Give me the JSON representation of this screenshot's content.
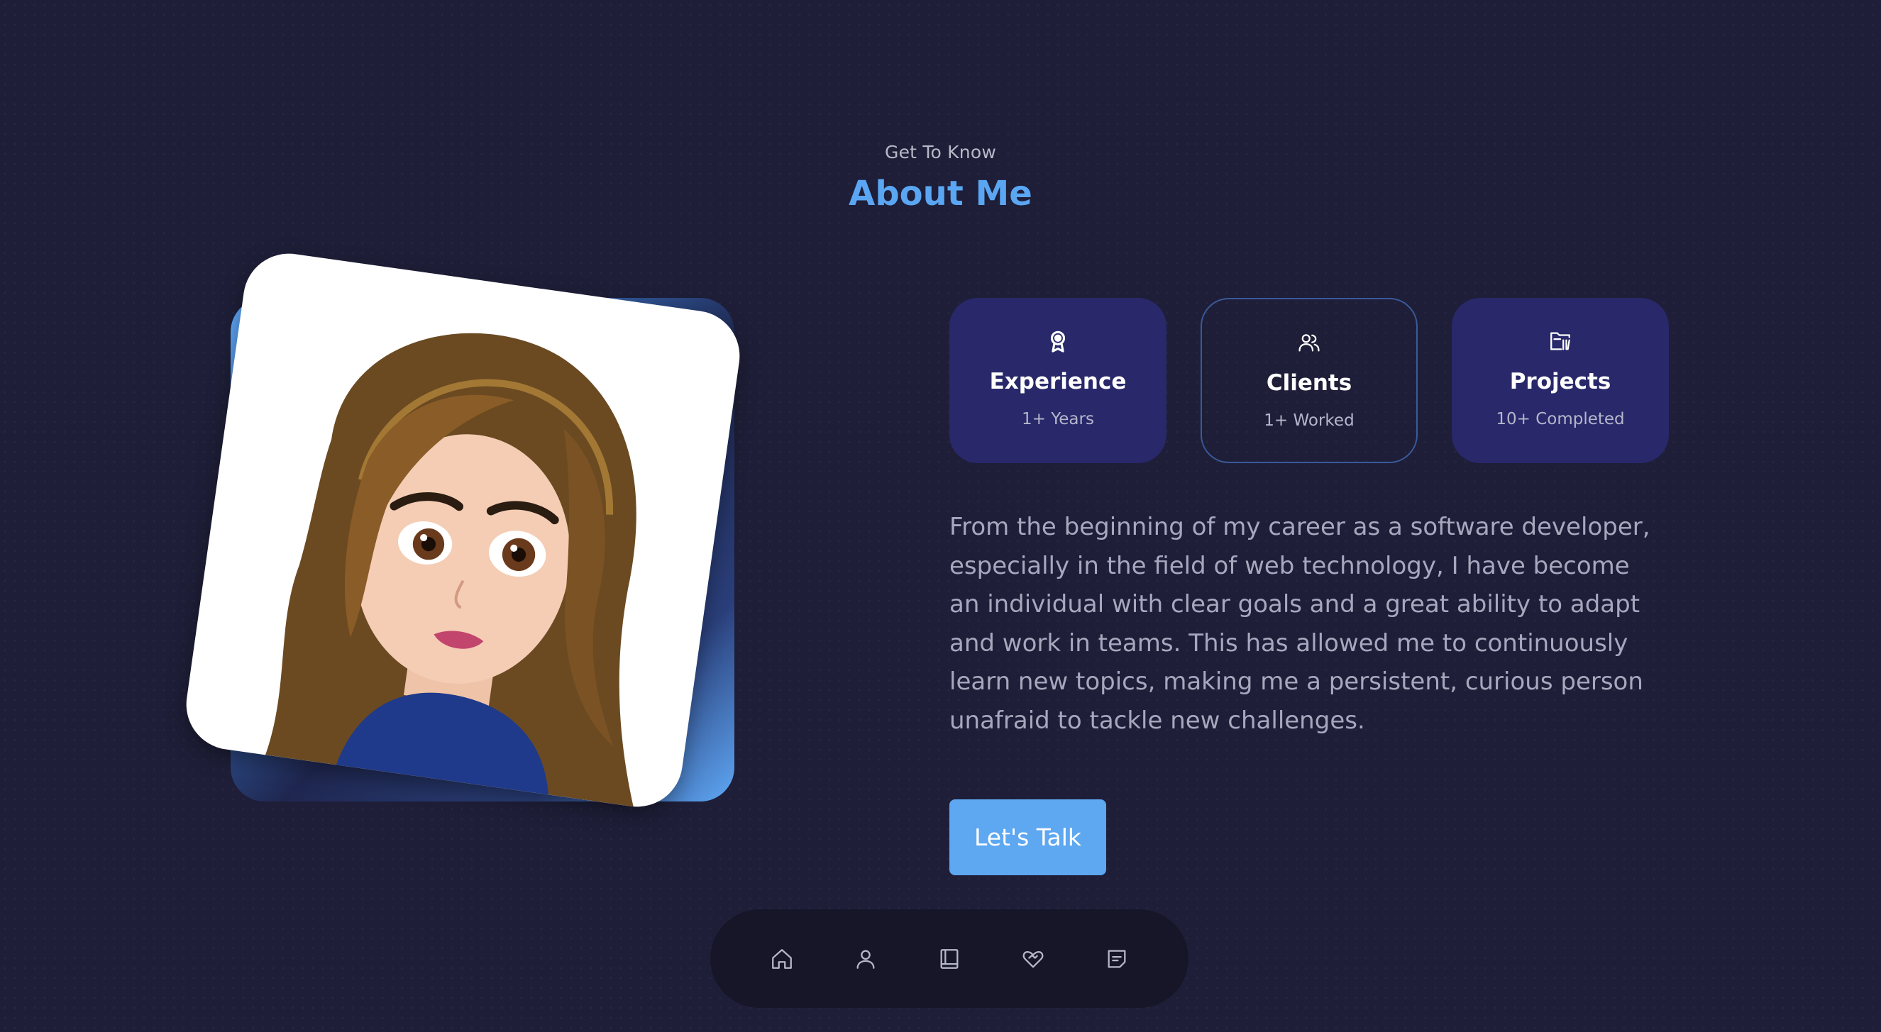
{
  "header": {
    "kicker": "Get To Know",
    "title": "About Me"
  },
  "portrait": {
    "icon": "avatar-illustration"
  },
  "stats": [
    {
      "icon": "award-icon",
      "title": "Experience",
      "subtitle": "1+ Years"
    },
    {
      "icon": "users-icon",
      "title": "Clients",
      "subtitle": "1+ Worked"
    },
    {
      "icon": "folder-icon",
      "title": "Projects",
      "subtitle": "10+ Completed"
    }
  ],
  "about": {
    "text": "From the beginning of my career as a software developer, especially in the field of web technology, I have become an individual with clear goals and a great ability to adapt and work in teams. This has allowed me to continuously learn new topics, making me a persistent, curious person unafraid to tackle new challenges."
  },
  "cta": {
    "label": "Let's Talk"
  },
  "dock": {
    "items": [
      {
        "icon": "home-icon"
      },
      {
        "icon": "user-icon"
      },
      {
        "icon": "book-icon"
      },
      {
        "icon": "heart-handshake-icon"
      },
      {
        "icon": "message-icon"
      }
    ]
  },
  "colors": {
    "background": "#1e1e38",
    "accent": "#5ea7f1",
    "card": "#28286a",
    "dock": "#161628"
  }
}
